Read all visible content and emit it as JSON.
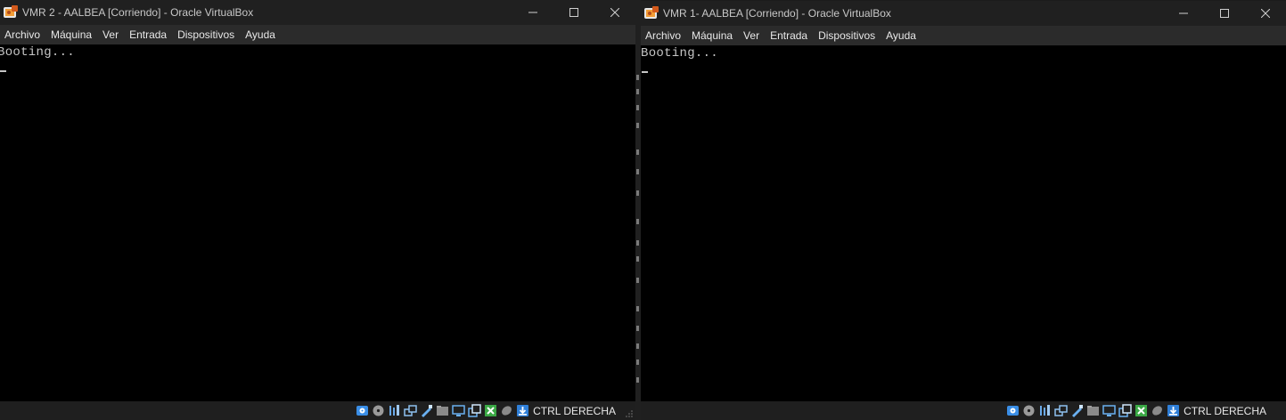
{
  "windows": [
    {
      "title": "VMR 2 - AALBEA [Corriendo] - Oracle VirtualBox",
      "menu": [
        "Archivo",
        "Máquina",
        "Ver",
        "Entrada",
        "Dispositivos",
        "Ayuda"
      ],
      "console_text": "Booting...",
      "host_key_label": "CTRL DERECHA"
    },
    {
      "title": "VMR 1- AALBEA [Corriendo] - Oracle VirtualBox",
      "menu": [
        "Archivo",
        "Máquina",
        "Ver",
        "Entrada",
        "Dispositivos",
        "Ayuda"
      ],
      "console_text": "Booting...",
      "host_key_label": "CTRL DERECHA"
    }
  ],
  "status_icons": [
    "hard-disk-icon",
    "optical-drive-icon",
    "audio-icon",
    "network-icon",
    "usb-icon",
    "shared-folders-icon",
    "display-icon",
    "video-capture-icon",
    "guest-additions-icon",
    "mouse-integration-icon",
    "keyboard-icon"
  ],
  "colors": {
    "titlebar": "#202020",
    "menubar": "#2b2b2b",
    "screen": "#000000",
    "console_text": "#c6c6c6"
  }
}
